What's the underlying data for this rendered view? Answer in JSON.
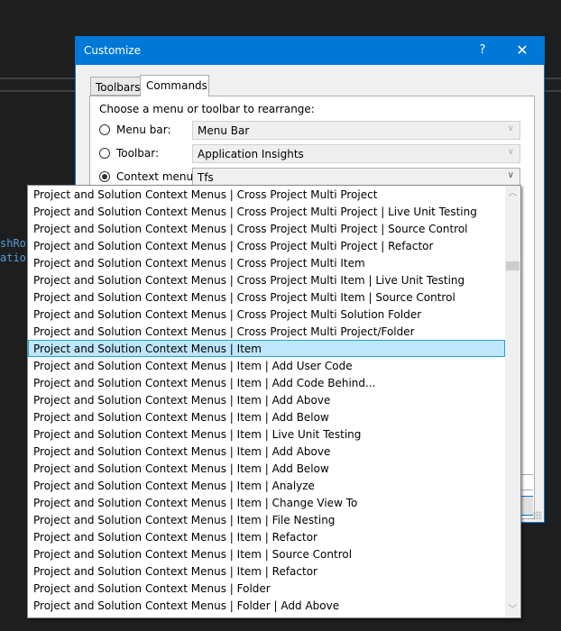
{
  "background": {
    "code_fragments": [
      "shRoc",
      "ation"
    ]
  },
  "dialog": {
    "title": "Customize",
    "help_label": "?",
    "close_label": "✕",
    "tabs": [
      {
        "label": "Toolbars",
        "active": false
      },
      {
        "label": "Commands",
        "active": true
      }
    ],
    "prompt": "Choose a menu or toolbar to rearrange:",
    "options": [
      {
        "label": "Menu bar:",
        "value": "Menu Bar",
        "checked": false
      },
      {
        "label": "Toolbar:",
        "value": "Application Insights",
        "checked": false
      },
      {
        "label": "Context menu:",
        "value": "Tfs",
        "checked": true
      }
    ]
  },
  "dropdown": {
    "selected_index": 9,
    "items": [
      "Project and Solution Context Menus | Cross Project Multi Project",
      "Project and Solution Context Menus | Cross Project Multi Project | Live Unit Testing",
      "Project and Solution Context Menus | Cross Project Multi Project | Source Control",
      "Project and Solution Context Menus | Cross Project Multi Project | Refactor",
      "Project and Solution Context Menus | Cross Project Multi Item",
      "Project and Solution Context Menus | Cross Project Multi Item | Live Unit Testing",
      "Project and Solution Context Menus | Cross Project Multi Item | Source Control",
      "Project and Solution Context Menus | Cross Project Multi Solution Folder",
      "Project and Solution Context Menus | Cross Project Multi Project/Folder",
      "Project and Solution Context Menus | Item",
      "Project and Solution Context Menus | Item | Add User Code",
      "Project and Solution Context Menus | Item | Add Code Behind...",
      "Project and Solution Context Menus | Item | Add Above",
      "Project and Solution Context Menus | Item | Add Below",
      "Project and Solution Context Menus | Item | Live Unit Testing",
      "Project and Solution Context Menus | Item | Add Above",
      "Project and Solution Context Menus | Item | Add Below",
      "Project and Solution Context Menus | Item | Analyze",
      "Project and Solution Context Menus | Item | Change View To",
      "Project and Solution Context Menus | Item | File Nesting",
      "Project and Solution Context Menus | Item | Refactor",
      "Project and Solution Context Menus | Item | Source Control",
      "Project and Solution Context Menus | Item | Refactor",
      "Project and Solution Context Menus | Folder",
      "Project and Solution Context Menus | Folder | Add Above"
    ],
    "scroll_up_icon": "︿",
    "scroll_down_icon": "﹀"
  }
}
